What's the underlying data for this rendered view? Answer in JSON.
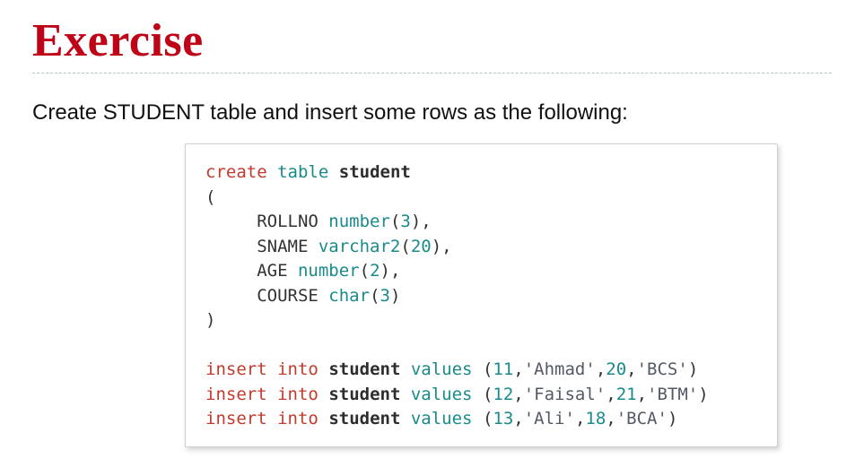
{
  "title": "Exercise",
  "intro": "Create STUDENT table and insert some rows as the following:",
  "code": {
    "l1_kw": "create",
    "l1_kw2": "table",
    "l1_ident": "student",
    "l2": "(",
    "col1_name": "ROLLNO",
    "col1_type": "number",
    "col1_size": "3",
    "col2_name": "SNAME",
    "col2_type": "varchar2",
    "col2_size": "20",
    "col3_name": "AGE",
    "col3_type": "number",
    "col3_size": "2",
    "col4_name": "COURSE",
    "col4_type": "char",
    "col4_size": "3",
    "close": ")",
    "ins_kw": "insert",
    "into_kw": "into",
    "values_kw": "values",
    "tbl": "student",
    "r1_id": "11",
    "r1_name": "'Ahmad'",
    "r1_age": "20",
    "r1_course": "'BCS'",
    "r2_id": "12",
    "r2_name": "'Faisal'",
    "r2_age": "21",
    "r2_course": "'BTM'",
    "r3_id": "13",
    "r3_name": "'Ali'",
    "r3_age": "18",
    "r3_course": "'BCA'"
  }
}
